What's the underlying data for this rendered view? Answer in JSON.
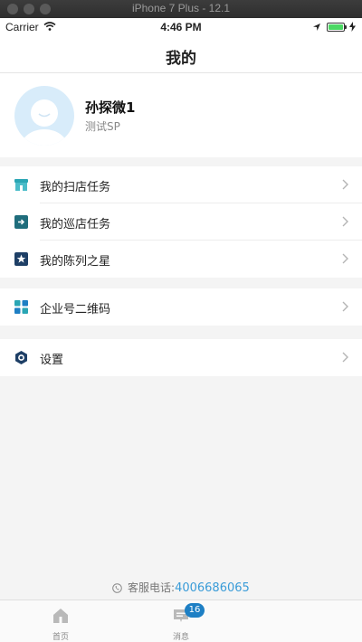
{
  "window": {
    "title": "iPhone 7 Plus - 12.1"
  },
  "status_bar": {
    "carrier": "Carrier",
    "time": "4:46 PM"
  },
  "nav": {
    "title": "我的"
  },
  "profile": {
    "name": "孙探微1",
    "role": "测试SP"
  },
  "menu_groups": [
    [
      {
        "label": "我的扫店任务",
        "icon": "store-icon"
      },
      {
        "label": "我的巡店任务",
        "icon": "patrol-icon"
      },
      {
        "label": "我的陈列之星",
        "icon": "star-icon"
      }
    ],
    [
      {
        "label": "企业号二维码",
        "icon": "qrcode-icon"
      }
    ],
    [
      {
        "label": "设置",
        "icon": "settings-icon"
      }
    ]
  ],
  "footer": {
    "service_label": "客服电话:",
    "service_phone": "4006686065"
  },
  "tabs": [
    {
      "label": "首页",
      "icon": "home-icon"
    },
    {
      "label": "消息",
      "icon": "message-icon",
      "badge": "16"
    }
  ],
  "colors": {
    "accent": "#3a9cd8",
    "icon_teal": "#2aa6b4",
    "icon_navy": "#1e3f66",
    "battery": "#4cd964"
  }
}
